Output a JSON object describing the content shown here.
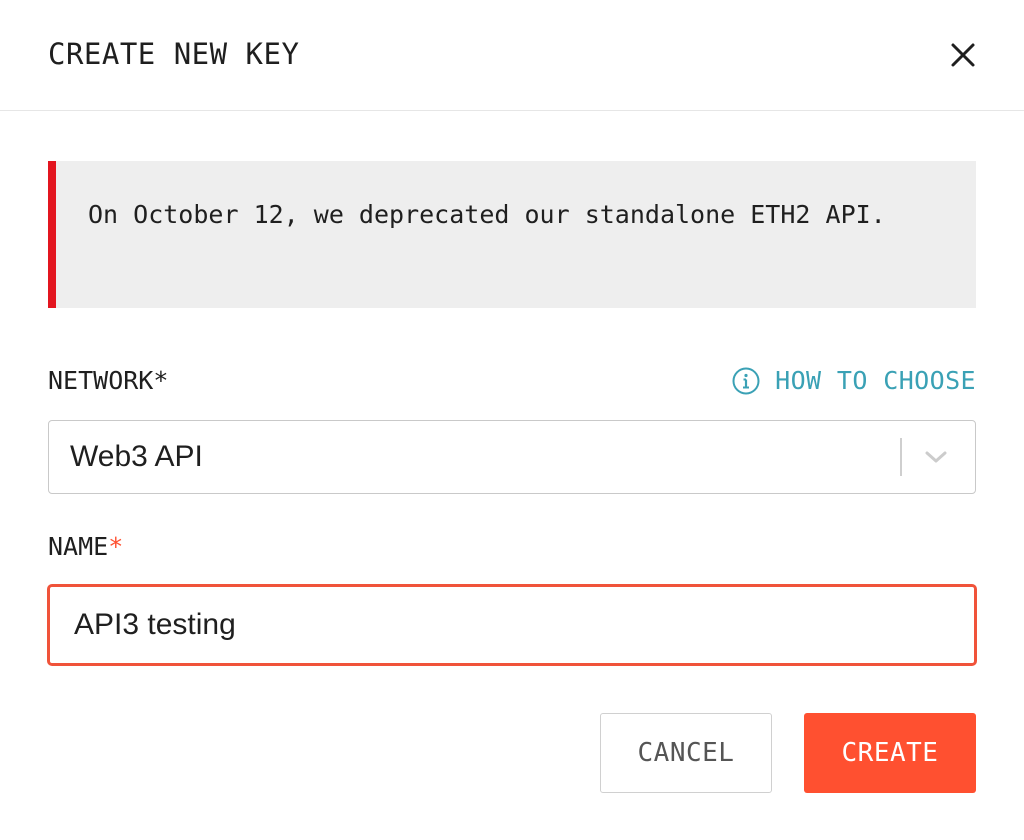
{
  "dialog": {
    "title": "CREATE NEW KEY",
    "close_icon": "close-icon"
  },
  "notice": {
    "text": "On October 12, we deprecated our standalone ETH2 API.",
    "accent_color": "#e3151f"
  },
  "network": {
    "label": "NETWORK*",
    "help_icon": "info-icon",
    "help_label": "HOW TO CHOOSE",
    "selected": "Web3 API",
    "chevron_icon": "chevron-down-icon"
  },
  "name": {
    "label": "NAME",
    "required_marker": "*",
    "value": "API3 testing"
  },
  "actions": {
    "cancel_label": "CANCEL",
    "create_label": "CREATE",
    "primary_color": "#ff5030"
  }
}
